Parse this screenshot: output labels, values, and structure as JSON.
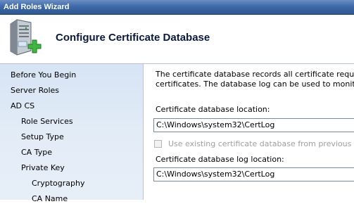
{
  "window": {
    "title": "Add Roles Wizard"
  },
  "header": {
    "title": "Configure Certificate Database",
    "icon": "server-add-icon"
  },
  "sidebar": {
    "items": [
      {
        "label": "Before You Begin"
      },
      {
        "label": "Server Roles"
      },
      {
        "label": "AD CS"
      },
      {
        "label": "Role Services"
      },
      {
        "label": "Setup Type"
      },
      {
        "label": "CA Type"
      },
      {
        "label": "Private Key"
      },
      {
        "label": "Cryptography"
      },
      {
        "label": "CA Name"
      }
    ]
  },
  "content": {
    "description": [
      "The certificate database records all certificate requests, iss",
      "certificates. The database log can be used to monitor mana"
    ],
    "db_location_label": "Certificate database location:",
    "db_location_value": "C:\\Windows\\system32\\CertLog",
    "use_existing_label": "Use existing certificate database from previous installa",
    "use_existing_checked": false,
    "log_location_label": "Certificate database log location:",
    "log_location_value": "C:\\Windows\\system32\\CertLog"
  },
  "colors": {
    "titlebar": "#3f6aa8",
    "sidebar": "#dfe9f6",
    "heading": "#0a1a3c"
  }
}
